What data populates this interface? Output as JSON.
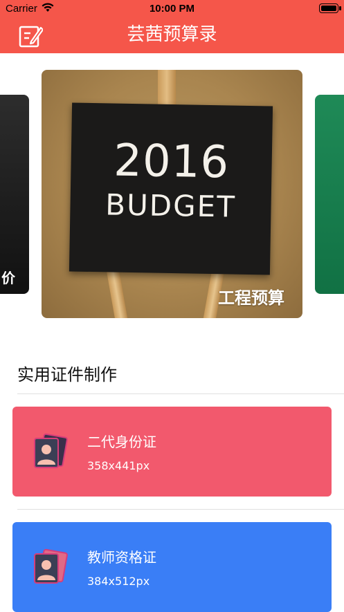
{
  "status_bar": {
    "carrier": "Carrier",
    "time": "10:00 PM"
  },
  "nav": {
    "title": "芸茜预算录",
    "edit_icon": "edit-note-icon"
  },
  "carousel": {
    "left_card_caption": "价",
    "main_card": {
      "board_line1": "2016",
      "board_line2": "BUDGET",
      "caption": "工程预算"
    }
  },
  "section": {
    "title": "实用证件制作"
  },
  "id_cards": [
    {
      "name": "二代身份证",
      "size": "358x441px",
      "color": "#f2596d",
      "icon": "id-photo-icon"
    },
    {
      "name": "教师资格证",
      "size": "384x512px",
      "color": "#3a7ef6",
      "icon": "id-photo-icon"
    }
  ],
  "colors": {
    "accent": "#f5564a"
  }
}
